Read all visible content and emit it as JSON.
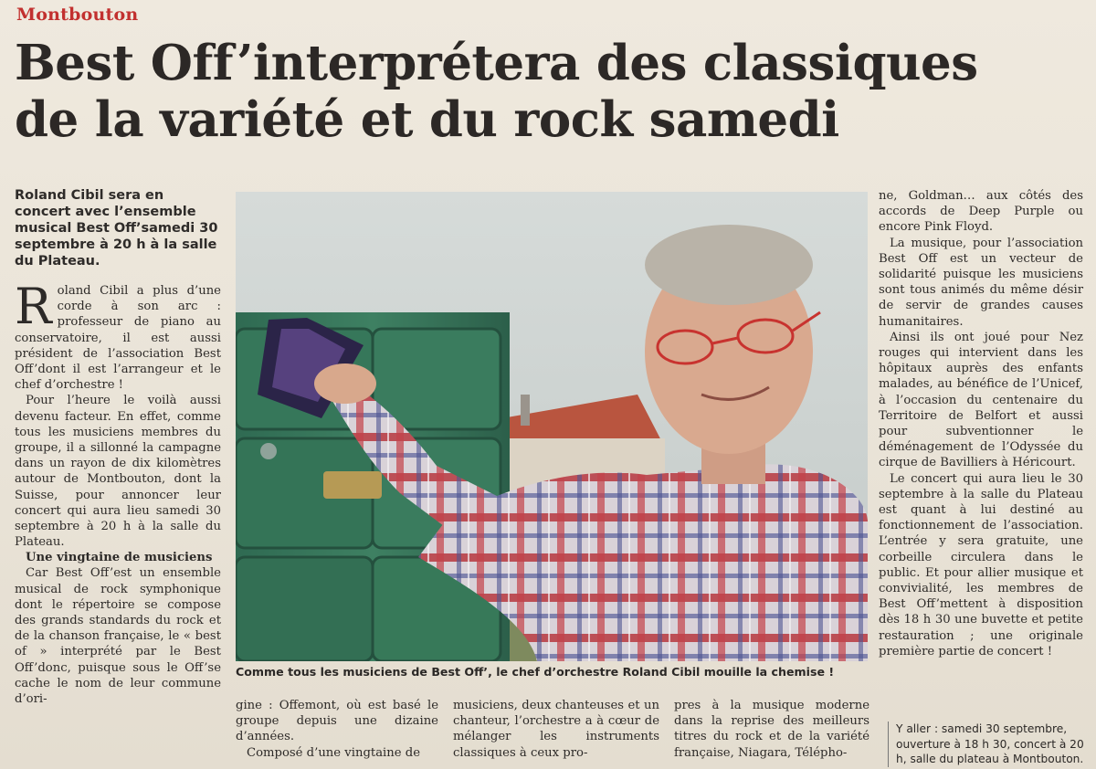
{
  "article": {
    "kicker": "Montbouton",
    "headline_line1": "Best Off’interprétera des classiques",
    "headline_line2": "de la variété et du rock samedi",
    "lede": "Roland Cibil sera en concert avec l’ensemble musical Best Off’samedi 30 septembre à 20 h à la salle du Plateau.",
    "dropcap": "R",
    "col1_p1": "oland Cibil a plus d’une corde à son arc : professeur de piano au conservatoire, il est aussi président de l’association Best Off’dont il est l’arrangeur et le chef d’orchestre !",
    "col1_p2": "Pour l’heure le voilà aussi devenu facteur. En effet, comme tous les musiciens membres du groupe, il a sillonné la campagne dans un rayon de dix kilomètres autour de Montbouton, dont la Suisse, pour annoncer leur concert qui aura lieu samedi 30 septembre à 20 h à la salle du Plateau.",
    "subhead": "Une vingtaine de musiciens",
    "col1_p3": "Car Best Off’est un ensemble musical de rock symphonique dont le répertoire se compose des grands standards du rock et de la chanson française, le « best of » interprété par le Best Off’donc, puisque sous le Off’se cache le nom de leur commune d’ori-",
    "caption": "Comme tous les musiciens de Best Off’, le chef d’orchestre Roland Cibil mouille la chemise !",
    "colb1_p1": "gine : Offemont, où est basé le groupe depuis une dizaine d’années.",
    "colb1_p2": "Composé d’une vingtaine de",
    "colb2_p1": "musiciens, deux chanteuses et un chanteur, l’orchestre a à cœur de mélanger les instruments classiques à ceux pro-",
    "colb3_p1": "pres à la musique moderne dans la reprise des meilleurs titres du rock et de la variété française, Niagara, Télépho-",
    "colr_p1": "ne, Goldman… aux côtés des accords de Deep Purple ou encore Pink Floyd.",
    "colr_p2": "La musique, pour l’association Best Off est un vecteur de solidarité puisque les musiciens sont tous animés du même désir de servir de grandes causes humanitaires.",
    "colr_p3": "Ainsi ils ont joué pour Nez rouges qui intervient dans les hôpitaux auprès des enfants malades, au bénéfice de l’Unicef, à l’occasion du centenaire du Territoire de Belfort et aussi pour subventionner le déménagement de l’Odyssée du cirque de Bavilliers à Héricourt.",
    "colr_p4": "Le concert qui aura lieu le 30 septembre à la salle du Plateau est quant à lui destiné au fonctionnement de l’association. L’entrée y sera gratuite, une corbeille circulera dans le public. Et pour allier musique et convivialité, les membres de Best Off’mettent à disposition dès 18 h 30 une buvette et petite restauration ; une originale première partie de concert !",
    "info": "Y aller : samedi 30 septembre, ouverture à 18 h 30, concert à 20 h, salle du plateau à Montbouton."
  },
  "colors": {
    "kicker": "#c2302f",
    "text": "#2c2826",
    "paper": "#ece6da"
  }
}
